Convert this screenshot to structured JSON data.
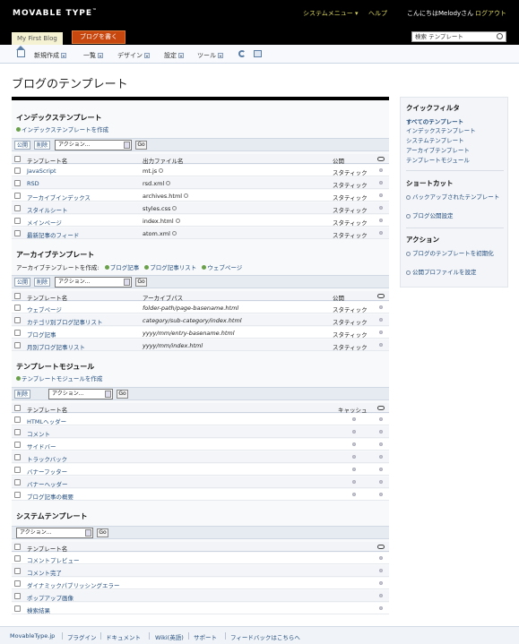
{
  "header": {
    "logo": "MOVABLE TYPE",
    "logo_tm": "™",
    "system_menu": "システムメニュー",
    "help": "ヘルプ",
    "greeting": "こんにちはMelodyさん",
    "logout": "ログアウト",
    "blog_name": "My First Blog",
    "write_button": "ブログを書く",
    "search_value": "検索 テンプレート"
  },
  "menu": [
    {
      "label": "新規作成"
    },
    {
      "label": "一覧"
    },
    {
      "label": "デザイン"
    },
    {
      "label": "設定"
    },
    {
      "label": "ツール"
    }
  ],
  "page_title": "ブログのテンプレート",
  "toolbar": {
    "publish": "公開",
    "delete": "削除",
    "action_select": "アクション...",
    "go": "Go"
  },
  "index_section": {
    "title": "インデックステンプレート",
    "create": "インデックステンプレートを作成",
    "headers": {
      "name": "テンプレート名",
      "file": "出力ファイル名",
      "status": "公開"
    },
    "rows": [
      {
        "name": "JavaScript",
        "file": "mt.js",
        "status": "スタティック"
      },
      {
        "name": "RSD",
        "file": "rsd.xml",
        "status": "スタティック"
      },
      {
        "name": "アーカイブインデックス",
        "file": "archives.html",
        "status": "スタティック"
      },
      {
        "name": "スタイルシート",
        "file": "styles.css",
        "status": "スタティック"
      },
      {
        "name": "メインページ",
        "file": "index.html",
        "status": "スタティック"
      },
      {
        "name": "最新記事のフィード",
        "file": "atom.xml",
        "status": "スタティック"
      }
    ]
  },
  "archive_section": {
    "title": "アーカイブテンプレート",
    "create_label": "アーカイブテンプレートを作成:",
    "create_links": [
      "ブログ記事",
      "ブログ記事リスト",
      "ウェブページ"
    ],
    "headers": {
      "name": "テンプレート名",
      "path": "アーカイブパス",
      "status": "公開"
    },
    "rows": [
      {
        "name": "ウェブページ",
        "path": "folder-path/page-basename.html",
        "status": "スタティック"
      },
      {
        "name": "カテゴリ別ブログ記事リスト",
        "path": "category/sub-category/index.html",
        "status": "スタティック"
      },
      {
        "name": "ブログ記事",
        "path": "yyyy/mm/entry-basename.html",
        "status": "スタティック"
      },
      {
        "name": "月別ブログ記事リスト",
        "path": "yyyy/mm/index.html",
        "status": "スタティック"
      }
    ]
  },
  "module_section": {
    "title": "テンプレートモジュール",
    "create": "テンプレートモジュールを作成",
    "headers": {
      "name": "テンプレート名",
      "cache": "キャッシュ"
    },
    "rows": [
      {
        "name": "HTMLヘッダー"
      },
      {
        "name": "コメント"
      },
      {
        "name": "サイドバー"
      },
      {
        "name": "トラックバック"
      },
      {
        "name": "バナーフッター"
      },
      {
        "name": "バナーヘッダー"
      },
      {
        "name": "ブログ記事の概要"
      }
    ]
  },
  "system_section": {
    "title": "システムテンプレート",
    "headers": {
      "name": "テンプレート名"
    },
    "rows": [
      {
        "name": "コメントプレビュー"
      },
      {
        "name": "コメント完了"
      },
      {
        "name": "ダイナミックパブリッシングエラー"
      },
      {
        "name": "ポップアップ画像"
      },
      {
        "name": "検索結果"
      }
    ]
  },
  "sidebar": {
    "quick_filter_title": "クイックフィルタ",
    "filters": [
      "すべてのテンプレート",
      "インデックステンプレート",
      "システムテンプレート",
      "アーカイブテンプレート",
      "テンプレートモジュール"
    ],
    "shortcut_title": "ショートカット",
    "shortcuts": [
      "バックアップされたテンプレート",
      "ブログ公開設定"
    ],
    "action_title": "アクション",
    "actions": [
      "ブログのテンプレートを初期化",
      "公開プロファイルを設定"
    ]
  },
  "footer": [
    "MovableType.jp",
    "プラグイン",
    "ドキュメント",
    "Wiki(英語)",
    "サポート",
    "フィードバックはこちらへ"
  ]
}
